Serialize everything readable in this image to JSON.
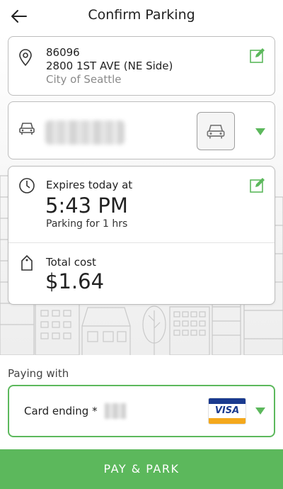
{
  "header": {
    "title": "Confirm Parking",
    "back_icon": "arrow-left-icon"
  },
  "location": {
    "zone": "86096",
    "address": "2800 1ST AVE  (NE Side)",
    "city": "City of Seattle",
    "icon": "map-pin-icon",
    "edit_icon": "edit-icon"
  },
  "vehicle": {
    "icon": "car-icon",
    "plate": "",
    "type_icon": "car-icon",
    "dropdown_icon": "chevron-down-icon"
  },
  "expiry": {
    "label": "Expires today at",
    "time": "5:43 PM",
    "duration": "Parking for 1 hrs",
    "icon": "clock-icon",
    "edit_icon": "edit-icon"
  },
  "cost": {
    "label": "Total cost",
    "value": "$1.64",
    "icon": "price-tag-icon"
  },
  "payment": {
    "section_label": "Paying with",
    "card_label": "Card ending *",
    "card_brand": "VISA",
    "dropdown_icon": "chevron-down-icon"
  },
  "pay_button": {
    "label": "PAY & PARK"
  },
  "colors": {
    "accent": "#5cb85c",
    "visa_blue": "#1a3a8f",
    "visa_gold": "#f4a81c"
  }
}
